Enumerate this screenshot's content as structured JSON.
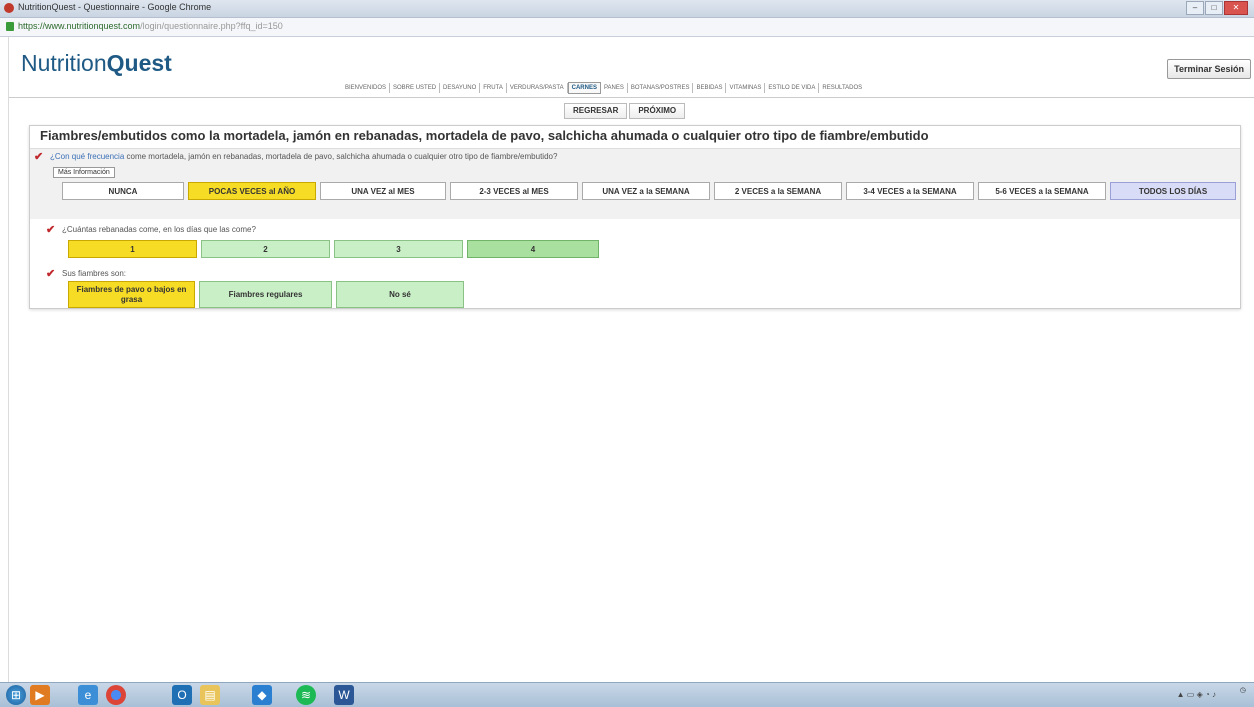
{
  "window": {
    "title": "NutritionQuest - Questionnaire - Google Chrome",
    "minimize": "–",
    "maximize": "□",
    "close": "✕"
  },
  "address": {
    "domain": "https://www.nutritionquest.com",
    "path": "/login/questionnaire.php?ffq_id=150"
  },
  "header": {
    "logo_light": "Nutrition",
    "logo_bold": "Quest",
    "logout_label": "Terminar Sesión"
  },
  "nav": {
    "items": [
      "BIENVENIDOS",
      "SOBRE USTED",
      "DESAYUNO",
      "FRUTA",
      "VERDURAS/PASTA",
      "CARNES",
      "PANES",
      "BOTANAS/POSTRES",
      "BEBIDAS",
      "VITAMINAS",
      "ESTILO DE VIDA",
      "RESULTADOS"
    ],
    "active_index": 5
  },
  "pager": {
    "back_label": "REGRESAR",
    "next_label": "PRÓXIMO"
  },
  "section": {
    "title": "Fiambres/embutidos como la mortadela, jamón en rebanadas, mortadela de pavo, salchicha ahumada o cualquier otro tipo de fiambre/embutido"
  },
  "q1": {
    "text_link": "¿Con qué frecuencia",
    "text_rest": " come mortadela, jamón en rebanadas, mortadela de pavo, salchicha ahumada o cualquier otro tipo de fiambre/embutido?",
    "info_label": "Más Información",
    "options": [
      "NUNCA",
      "POCAS VECES al AÑO",
      "UNA VEZ al MES",
      "2-3 VECES al MES",
      "UNA VEZ a la SEMANA",
      "2 VECES a la SEMANA",
      "3-4 VECES a la SEMANA",
      "5-6 VECES a la SEMANA",
      "TODOS LOS DÍAS"
    ],
    "selected": "POCAS VECES al AÑO"
  },
  "q2": {
    "text": "¿Cuántas rebanadas come, en los días que las come?",
    "options": [
      "1",
      "2",
      "3",
      "4"
    ],
    "selected": "1"
  },
  "q3": {
    "text": "Sus fiambres son:",
    "options": [
      "Fiambres de pavo o bajos en grasa",
      "Fiambres regulares",
      "No sé"
    ],
    "selected": "Fiambres de pavo o bajos en grasa"
  },
  "taskbar": {
    "icons": [
      "start-orb-icon",
      "media-player-icon",
      "internet-explorer-icon",
      "chrome-icon",
      "outlook-icon",
      "file-explorer-icon",
      "dropbox-icon",
      "spotify-icon",
      "word-icon"
    ]
  },
  "colors": {
    "selected": "#f7dc25",
    "lavender": "#d9dcf6",
    "green_light": "#c9efc6",
    "green_dark": "#a9e09f",
    "brand": "#1f5a85"
  }
}
